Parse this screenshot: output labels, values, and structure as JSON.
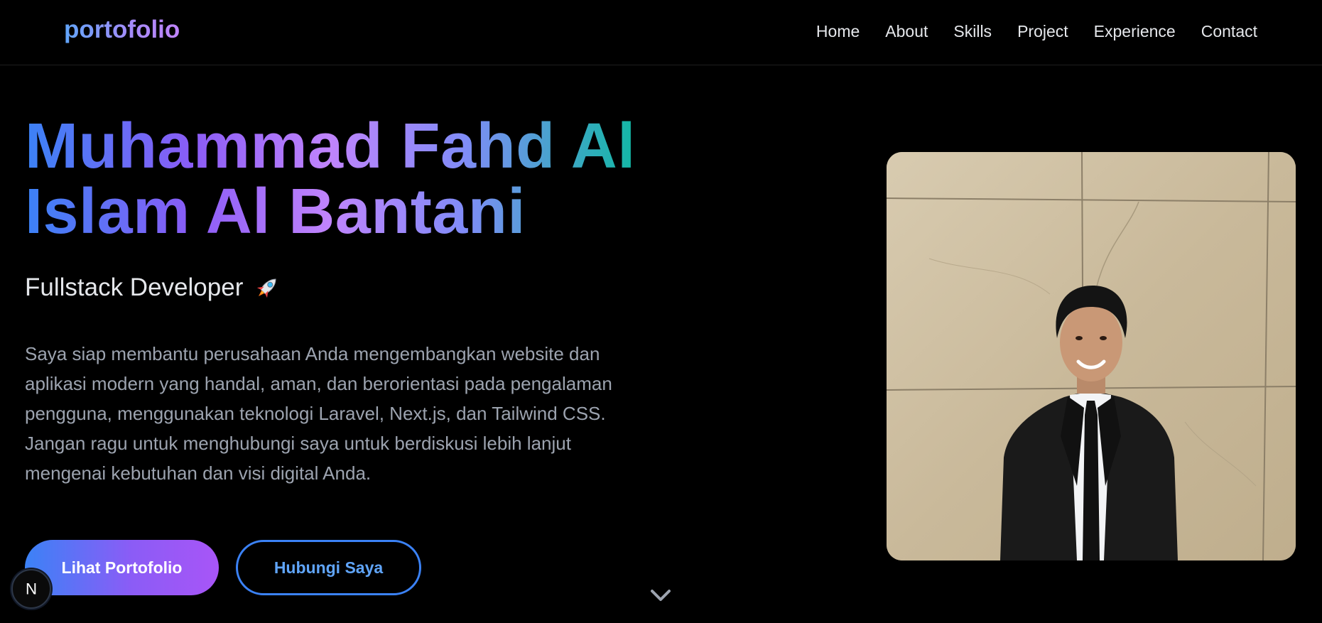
{
  "nav": {
    "logo": "portofolio",
    "links": [
      {
        "label": "Home"
      },
      {
        "label": "About"
      },
      {
        "label": "Skills"
      },
      {
        "label": "Project"
      },
      {
        "label": "Experience"
      },
      {
        "label": "Contact"
      }
    ]
  },
  "hero": {
    "title_line1": "Muhammad Fahd Al",
    "title_line2": "Islam Al Bantani",
    "subtitle": "Fullstack Developer",
    "subtitle_icon": "rocket-icon",
    "description": "Saya siap membantu perusahaan Anda mengembangkan website dan aplikasi modern yang handal, aman, dan berorientasi pada pengalaman pengguna, menggunakan teknologi Laravel, Next.js, dan Tailwind CSS. Jangan ragu untuk menghubungi saya untuk berdiskusi lebih lanjut mengenai kebutuhan dan visi digital Anda.",
    "primary_button": "Lihat Portofolio",
    "secondary_button": "Hubungi Saya"
  },
  "badge": {
    "letter": "N"
  },
  "icons": {
    "scroll": "chevron-down-icon",
    "badge": "nextjs-icon"
  },
  "colors": {
    "background": "#000000",
    "accent_blue": "#3b82f6",
    "accent_purple": "#a855f7",
    "accent_teal": "#14b8a6",
    "text_muted": "#9ca3af",
    "text_light": "#e5e7eb"
  }
}
